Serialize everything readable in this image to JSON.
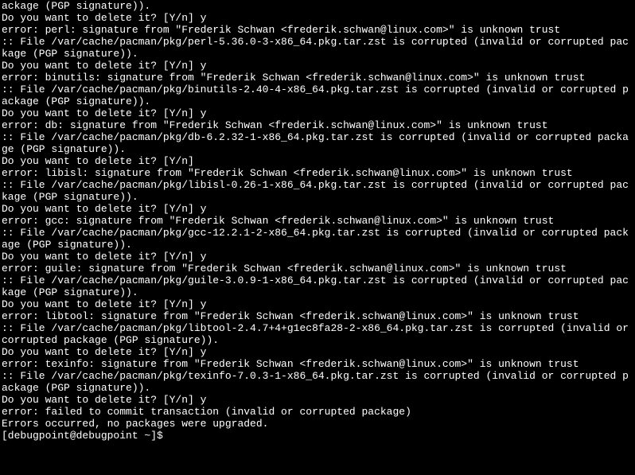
{
  "terminal": {
    "lines": [
      "ackage (PGP signature)).",
      "Do you want to delete it? [Y/n] y",
      "error: perl: signature from \"Frederik Schwan <frederik.schwan@linux.com>\" is unknown trust",
      ":: File /var/cache/pacman/pkg/perl-5.36.0-3-x86_64.pkg.tar.zst is corrupted (invalid or corrupted package (PGP signature)).",
      "Do you want to delete it? [Y/n] y",
      "error: binutils: signature from \"Frederik Schwan <frederik.schwan@linux.com>\" is unknown trust",
      ":: File /var/cache/pacman/pkg/binutils-2.40-4-x86_64.pkg.tar.zst is corrupted (invalid or corrupted package (PGP signature)).",
      "Do you want to delete it? [Y/n] y",
      "error: db: signature from \"Frederik Schwan <frederik.schwan@linux.com>\" is unknown trust",
      ":: File /var/cache/pacman/pkg/db-6.2.32-1-x86_64.pkg.tar.zst is corrupted (invalid or corrupted package (PGP signature)).",
      "Do you want to delete it? [Y/n]",
      "error: libisl: signature from \"Frederik Schwan <frederik.schwan@linux.com>\" is unknown trust",
      ":: File /var/cache/pacman/pkg/libisl-0.26-1-x86_64.pkg.tar.zst is corrupted (invalid or corrupted package (PGP signature)).",
      "Do you want to delete it? [Y/n] y",
      "error: gcc: signature from \"Frederik Schwan <frederik.schwan@linux.com>\" is unknown trust",
      ":: File /var/cache/pacman/pkg/gcc-12.2.1-2-x86_64.pkg.tar.zst is corrupted (invalid or corrupted package (PGP signature)).",
      "Do you want to delete it? [Y/n] y",
      "error: guile: signature from \"Frederik Schwan <frederik.schwan@linux.com>\" is unknown trust",
      ":: File /var/cache/pacman/pkg/guile-3.0.9-1-x86_64.pkg.tar.zst is corrupted (invalid or corrupted package (PGP signature)).",
      "Do you want to delete it? [Y/n] y",
      "error: libtool: signature from \"Frederik Schwan <frederik.schwan@linux.com>\" is unknown trust",
      ":: File /var/cache/pacman/pkg/libtool-2.4.7+4+g1ec8fa28-2-x86_64.pkg.tar.zst is corrupted (invalid or corrupted package (PGP signature)).",
      "Do you want to delete it? [Y/n] y",
      "error: texinfo: signature from \"Frederik Schwan <frederik.schwan@linux.com>\" is unknown trust",
      ":: File /var/cache/pacman/pkg/texinfo-7.0.3-1-x86_64.pkg.tar.zst is corrupted (invalid or corrupted package (PGP signature)).",
      "Do you want to delete it? [Y/n] y",
      "error: failed to commit transaction (invalid or corrupted package)",
      "Errors occurred, no packages were upgraded."
    ],
    "prompt": "[debugpoint@debugpoint ~]$"
  }
}
